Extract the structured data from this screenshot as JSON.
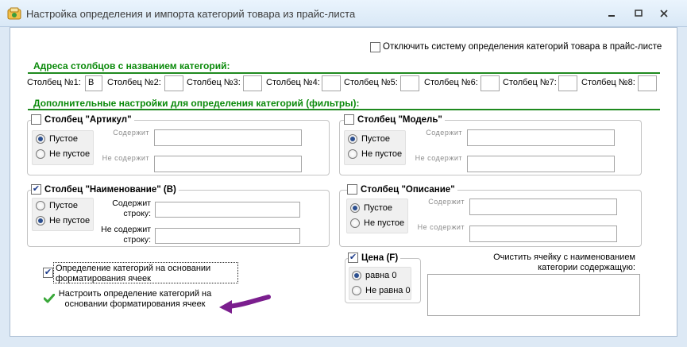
{
  "window": {
    "title": "Настройка определения и импорта категорий товара из прайс-листа",
    "minimize_icon": "minimize-icon",
    "maximize_icon": "maximize-icon",
    "close_icon": "close-icon"
  },
  "disable_system": {
    "label": "Отключить систему определения категорий товара в прайс-листе",
    "checked": false
  },
  "addresses": {
    "heading": "Адреса столбцов с названием категорий:",
    "columns": [
      {
        "label": "Столбец №1:",
        "value": "B"
      },
      {
        "label": "Столбец №2:",
        "value": ""
      },
      {
        "label": "Столбец №3:",
        "value": ""
      },
      {
        "label": "Столбец №4:",
        "value": ""
      },
      {
        "label": "Столбец №5:",
        "value": ""
      },
      {
        "label": "Столбец №6:",
        "value": ""
      },
      {
        "label": "Столбец №7:",
        "value": ""
      },
      {
        "label": "Столбец №8:",
        "value": ""
      }
    ]
  },
  "filters": {
    "heading": "Дополнительные настройки для определения категорий (фильтры):",
    "article": {
      "title": "Столбец \"Артикул\"",
      "checked": false,
      "empty": "Пустое",
      "not_empty": "Не пустое",
      "selected": "empty",
      "contains": "Содержит",
      "not_contains": "Не содержит",
      "contains_value": "",
      "not_contains_value": ""
    },
    "model": {
      "title": "Столбец \"Модель\"",
      "checked": false,
      "empty": "Пустое",
      "not_empty": "Не пустое",
      "selected": "empty",
      "contains": "Содержит",
      "not_contains": "Не содержит",
      "contains_value": "",
      "not_contains_value": ""
    },
    "name": {
      "title": "Столбец \"Наименование\" (B)",
      "checked": true,
      "empty": "Пустое",
      "not_empty": "Не пустое",
      "selected": "not_empty",
      "contains_line1": "Содержит",
      "contains_line2": "строку:",
      "not_contains_line1": "Не содержит",
      "not_contains_line2": "строку:",
      "contains_value": "",
      "not_contains_value": ""
    },
    "description": {
      "title": "Столбец \"Описание\"",
      "checked": false,
      "empty": "Пустое",
      "not_empty": "Не пустое",
      "selected": "empty",
      "contains": "Содержит",
      "not_contains": "Не содержит",
      "contains_value": "",
      "not_contains_value": ""
    },
    "price": {
      "title": "Цена (F)",
      "checked": true,
      "equal": "равна 0",
      "not_equal": "Не равна 0",
      "selected": "equal"
    }
  },
  "format_detect": {
    "checkbox_label_1": "Определение категорий на основании",
    "checkbox_label_2": "форматирования ячеек",
    "checked": true,
    "link_line1": "Настроить определение категорий на",
    "link_line2": "основании форматирования ячеек",
    "link_icon": "checkmark-icon",
    "arrow_color": "#7b1e8e"
  },
  "clear_cell": {
    "line1": "Очистить ячейку с наименованием",
    "line2": "категории содержащую:",
    "value": ""
  },
  "colors": {
    "heading_green": "#0a8a0a",
    "accent_blue": "#1d3b8a"
  }
}
